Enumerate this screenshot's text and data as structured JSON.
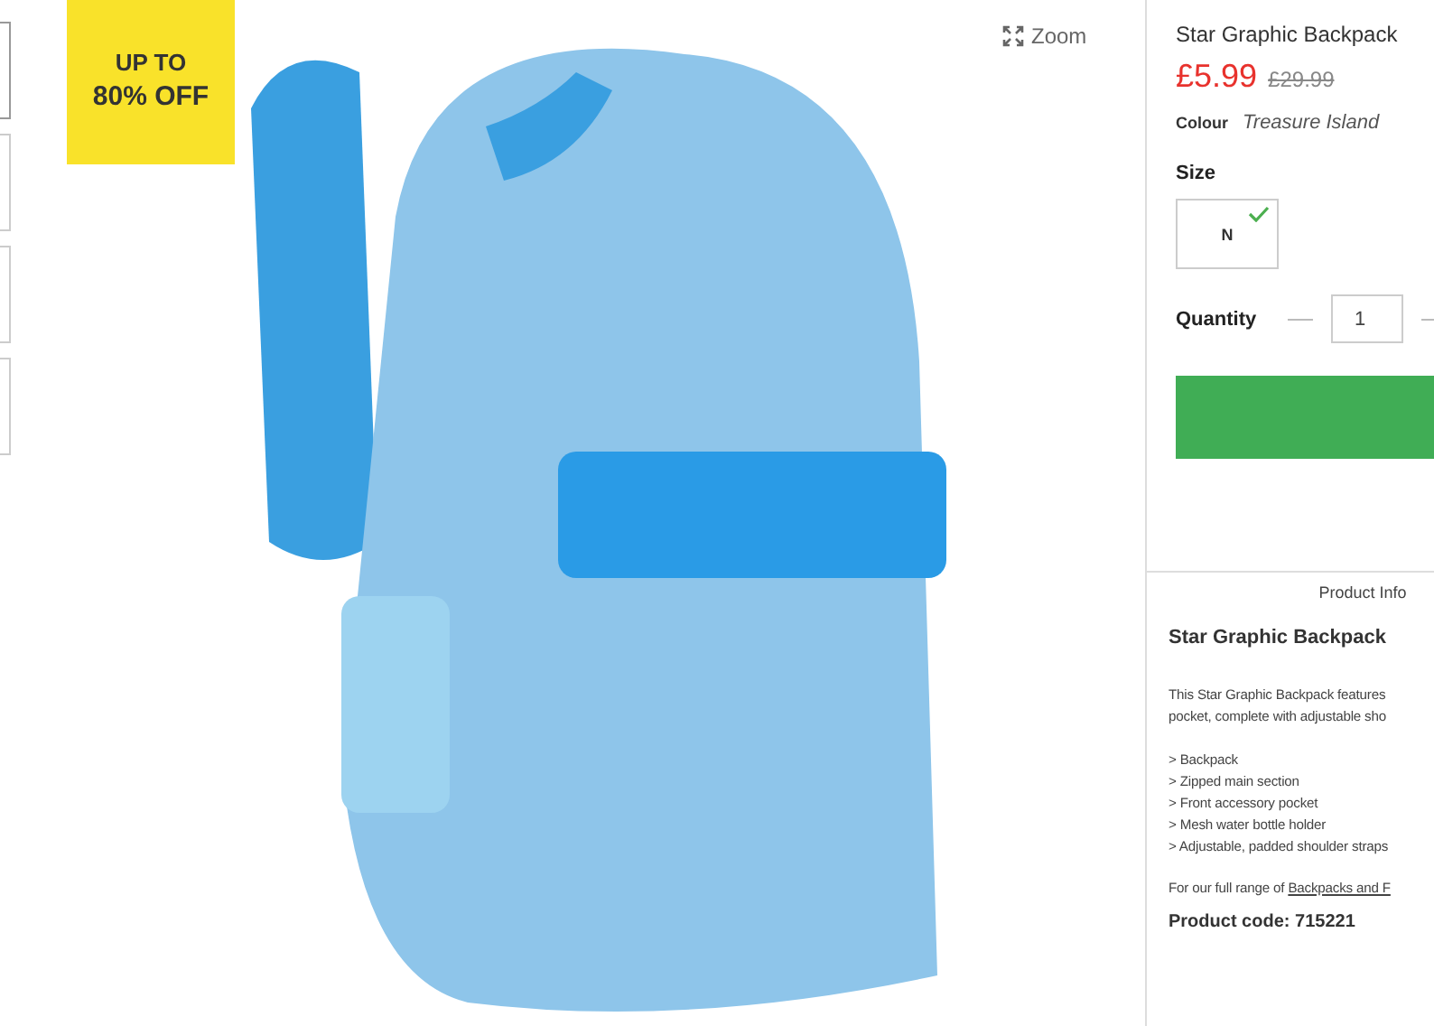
{
  "badge": {
    "line_1": "UP TO",
    "line_2": "80% OFF"
  },
  "zoom": {
    "label": "Zoom"
  },
  "product": {
    "title": "Star Graphic Backpack",
    "price": "£5.99",
    "old_price": "£29.99",
    "colour_label": "Colour",
    "colour_value": "Treasure Island",
    "size_label": "Size",
    "sizes": [
      {
        "label": "N",
        "selected": true
      }
    ],
    "quantity_label": "Quantity",
    "quantity": "1"
  },
  "product_info": {
    "heading": "Product Info",
    "title": "Star Graphic Backpack",
    "description_lines": [
      "This Star Graphic Backpack features",
      "pocket, complete with adjustable sho"
    ],
    "features": [
      "> Backpack",
      "> Zipped main section",
      "> Front accessory pocket",
      "> Mesh water bottle holder",
      "> Adjustable, padded shoulder straps"
    ],
    "range_text": "For our full range of ",
    "range_link": "Backpacks and F",
    "product_code": "Product code: 715221"
  }
}
